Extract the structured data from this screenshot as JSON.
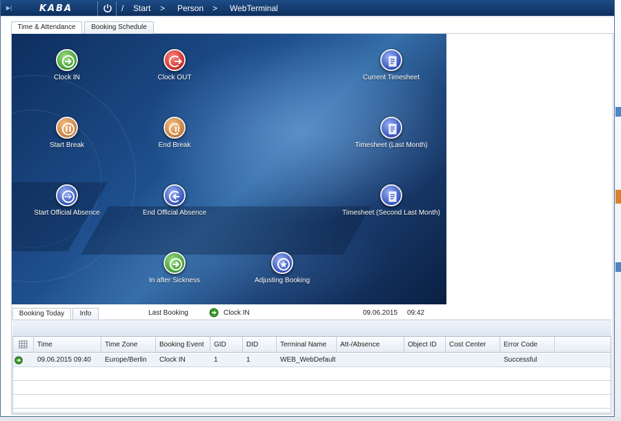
{
  "header": {
    "logo": "KABA",
    "breadcrumb": {
      "root": "/",
      "items": [
        "Start",
        "Person",
        "WebTerminal"
      ],
      "separator": ">"
    }
  },
  "tabs": {
    "main": [
      "Time & Attendance",
      "Booking Schedule"
    ],
    "active_main": "Time & Attendance"
  },
  "actions": {
    "clock_in": "Clock IN",
    "clock_out": "Clock OUT",
    "current_timesheet": "Current Timesheet",
    "start_break": "Start Break",
    "end_break": "End Break",
    "timesheet_last_month": "Timesheet (Last Month)",
    "start_official_absence": "Start Official Absence",
    "end_official_absence": "End Official Absence",
    "timesheet_second_last_month": "Timesheet (Second Last Month)",
    "in_after_sickness": "In after Sickness",
    "adjusting_booking": "Adjusting Booking"
  },
  "lower_tabs": [
    "Booking Today",
    "Info"
  ],
  "last_booking": {
    "label": "Last Booking",
    "event": "Clock IN",
    "date": "09.06.2015",
    "time": "09:42"
  },
  "table": {
    "columns": [
      "Time",
      "Time Zone",
      "Booking Event",
      "GID",
      "DID",
      "Terminal Name",
      "Att-/Absence",
      "Object ID",
      "Cost Center",
      "Error Code"
    ],
    "rows": [
      {
        "time": "09.06.2015 09:40",
        "time_zone": "Europe/Berlin",
        "booking_event": "Clock IN",
        "gid": "1",
        "did": "1",
        "terminal_name": "WEB_WebDefault",
        "att_absence": "",
        "object_id": "",
        "cost_center": "",
        "error_code": "Successful"
      }
    ]
  },
  "icons": {
    "collapse": "collapse-icon",
    "power": "power-icon",
    "table_settings": "grid-settings-icon",
    "status_ok": "green-arrow-icon"
  },
  "colors": {
    "nav_bar": "#0d2f5e",
    "clock_in": "#3d9b2c",
    "clock_out": "#c92a25",
    "break": "#c97b35",
    "absence": "#3350b8"
  }
}
